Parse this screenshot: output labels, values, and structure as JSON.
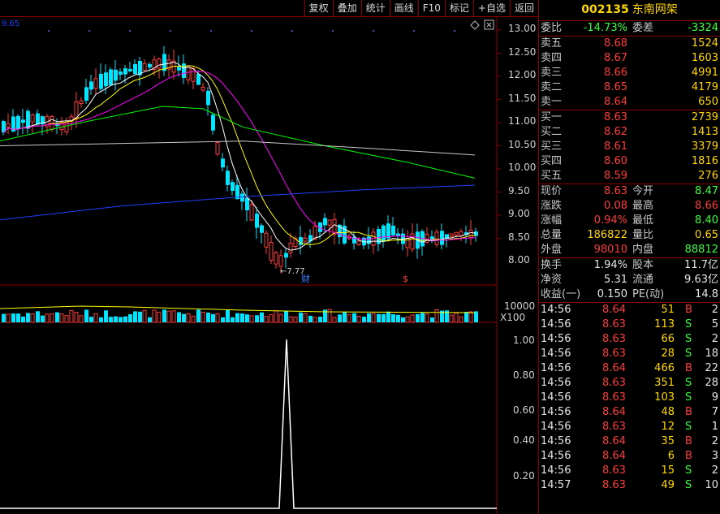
{
  "toolbar": {
    "buttons": [
      "复权",
      "叠加",
      "统计",
      "画线",
      "F10",
      "标记",
      "+自选",
      "返回"
    ]
  },
  "chart": {
    "ma_label": "9.65",
    "price_ticks": [
      "13.00",
      "12.50",
      "12.00",
      "11.50",
      "11.00",
      "10.50",
      "10.00",
      "9.50",
      "9.00",
      "8.50",
      "8.00"
    ],
    "low_marker": "7.77",
    "event_cai": "财",
    "event_s": "$",
    "volume_tick": "10000",
    "volume_unit": "X100",
    "indicator_ticks": [
      "1.00",
      "0.80",
      "0.60",
      "0.40",
      "0.20"
    ],
    "colors": {
      "up": "#ff3c3c",
      "down": "#00e5ff",
      "grid": "#8b0000",
      "ma5": "#ffffff",
      "ma10": "#ffff00",
      "ma20": "#ff00ff",
      "ma60": "#00ff00",
      "ma120": "#c8c8c8",
      "ma250": "#2040ff"
    }
  },
  "stock": {
    "code": "002135",
    "name": "东南网架"
  },
  "stats_top": {
    "label1": "委比",
    "value1": "-14.73%",
    "label2": "委差",
    "value2": "-3324"
  },
  "sells": [
    {
      "label": "卖五",
      "price": "8.68",
      "vol": "1524"
    },
    {
      "label": "卖四",
      "price": "8.67",
      "vol": "1603"
    },
    {
      "label": "卖三",
      "price": "8.66",
      "vol": "4991"
    },
    {
      "label": "卖二",
      "price": "8.65",
      "vol": "4179"
    },
    {
      "label": "卖一",
      "price": "8.64",
      "vol": "650"
    }
  ],
  "buys": [
    {
      "label": "买一",
      "price": "8.63",
      "vol": "2739"
    },
    {
      "label": "买二",
      "price": "8.62",
      "vol": "1413"
    },
    {
      "label": "买三",
      "price": "8.61",
      "vol": "3379"
    },
    {
      "label": "买四",
      "price": "8.60",
      "vol": "1816"
    },
    {
      "label": "买五",
      "price": "8.59",
      "vol": "276"
    }
  ],
  "quote1": [
    {
      "l1": "现价",
      "v1": "8.63",
      "l2": "今开",
      "v2": "8.47"
    },
    {
      "l1": "涨跌",
      "v1": "0.08",
      "l2": "最高",
      "v2": "8.66"
    },
    {
      "l1": "涨幅",
      "v1": "0.94%",
      "l2": "最低",
      "v2": "8.40"
    },
    {
      "l1": "总量",
      "v1": "186822",
      "l2": "量比",
      "v2": "0.65"
    },
    {
      "l1": "外盘",
      "v1": "98010",
      "l2": "内盘",
      "v2": "88812"
    }
  ],
  "quote2": [
    {
      "l1": "换手",
      "v1": "1.94%",
      "l2": "股本",
      "v2": "11.7亿"
    },
    {
      "l1": "净资",
      "v1": "5.31",
      "l2": "流通",
      "v2": "9.63亿"
    },
    {
      "l1": "收益(一)",
      "v1": "0.150",
      "l2": "PE(动)",
      "v2": "14.8"
    }
  ],
  "ticks": [
    {
      "time": "14:56",
      "price": "8.64",
      "vol": "51",
      "side": "B",
      "num": "2"
    },
    {
      "time": "14:56",
      "price": "8.63",
      "vol": "113",
      "side": "S",
      "num": "5"
    },
    {
      "time": "14:56",
      "price": "8.63",
      "vol": "66",
      "side": "S",
      "num": "2"
    },
    {
      "time": "14:56",
      "price": "8.63",
      "vol": "28",
      "side": "S",
      "num": "18"
    },
    {
      "time": "14:56",
      "price": "8.64",
      "vol": "466",
      "side": "B",
      "num": "22"
    },
    {
      "time": "14:56",
      "price": "8.63",
      "vol": "351",
      "side": "S",
      "num": "28"
    },
    {
      "time": "14:56",
      "price": "8.63",
      "vol": "103",
      "side": "S",
      "num": "9"
    },
    {
      "time": "14:56",
      "price": "8.64",
      "vol": "48",
      "side": "B",
      "num": "7"
    },
    {
      "time": "14:56",
      "price": "8.63",
      "vol": "12",
      "side": "S",
      "num": "1"
    },
    {
      "time": "14:56",
      "price": "8.64",
      "vol": "35",
      "side": "B",
      "num": "2"
    },
    {
      "time": "14:56",
      "price": "8.64",
      "vol": "6",
      "side": "B",
      "num": "3"
    },
    {
      "time": "14:56",
      "price": "8.63",
      "vol": "15",
      "side": "S",
      "num": "2"
    },
    {
      "time": "14:57",
      "price": "8.63",
      "vol": "49",
      "side": "S",
      "num": "10"
    }
  ]
}
